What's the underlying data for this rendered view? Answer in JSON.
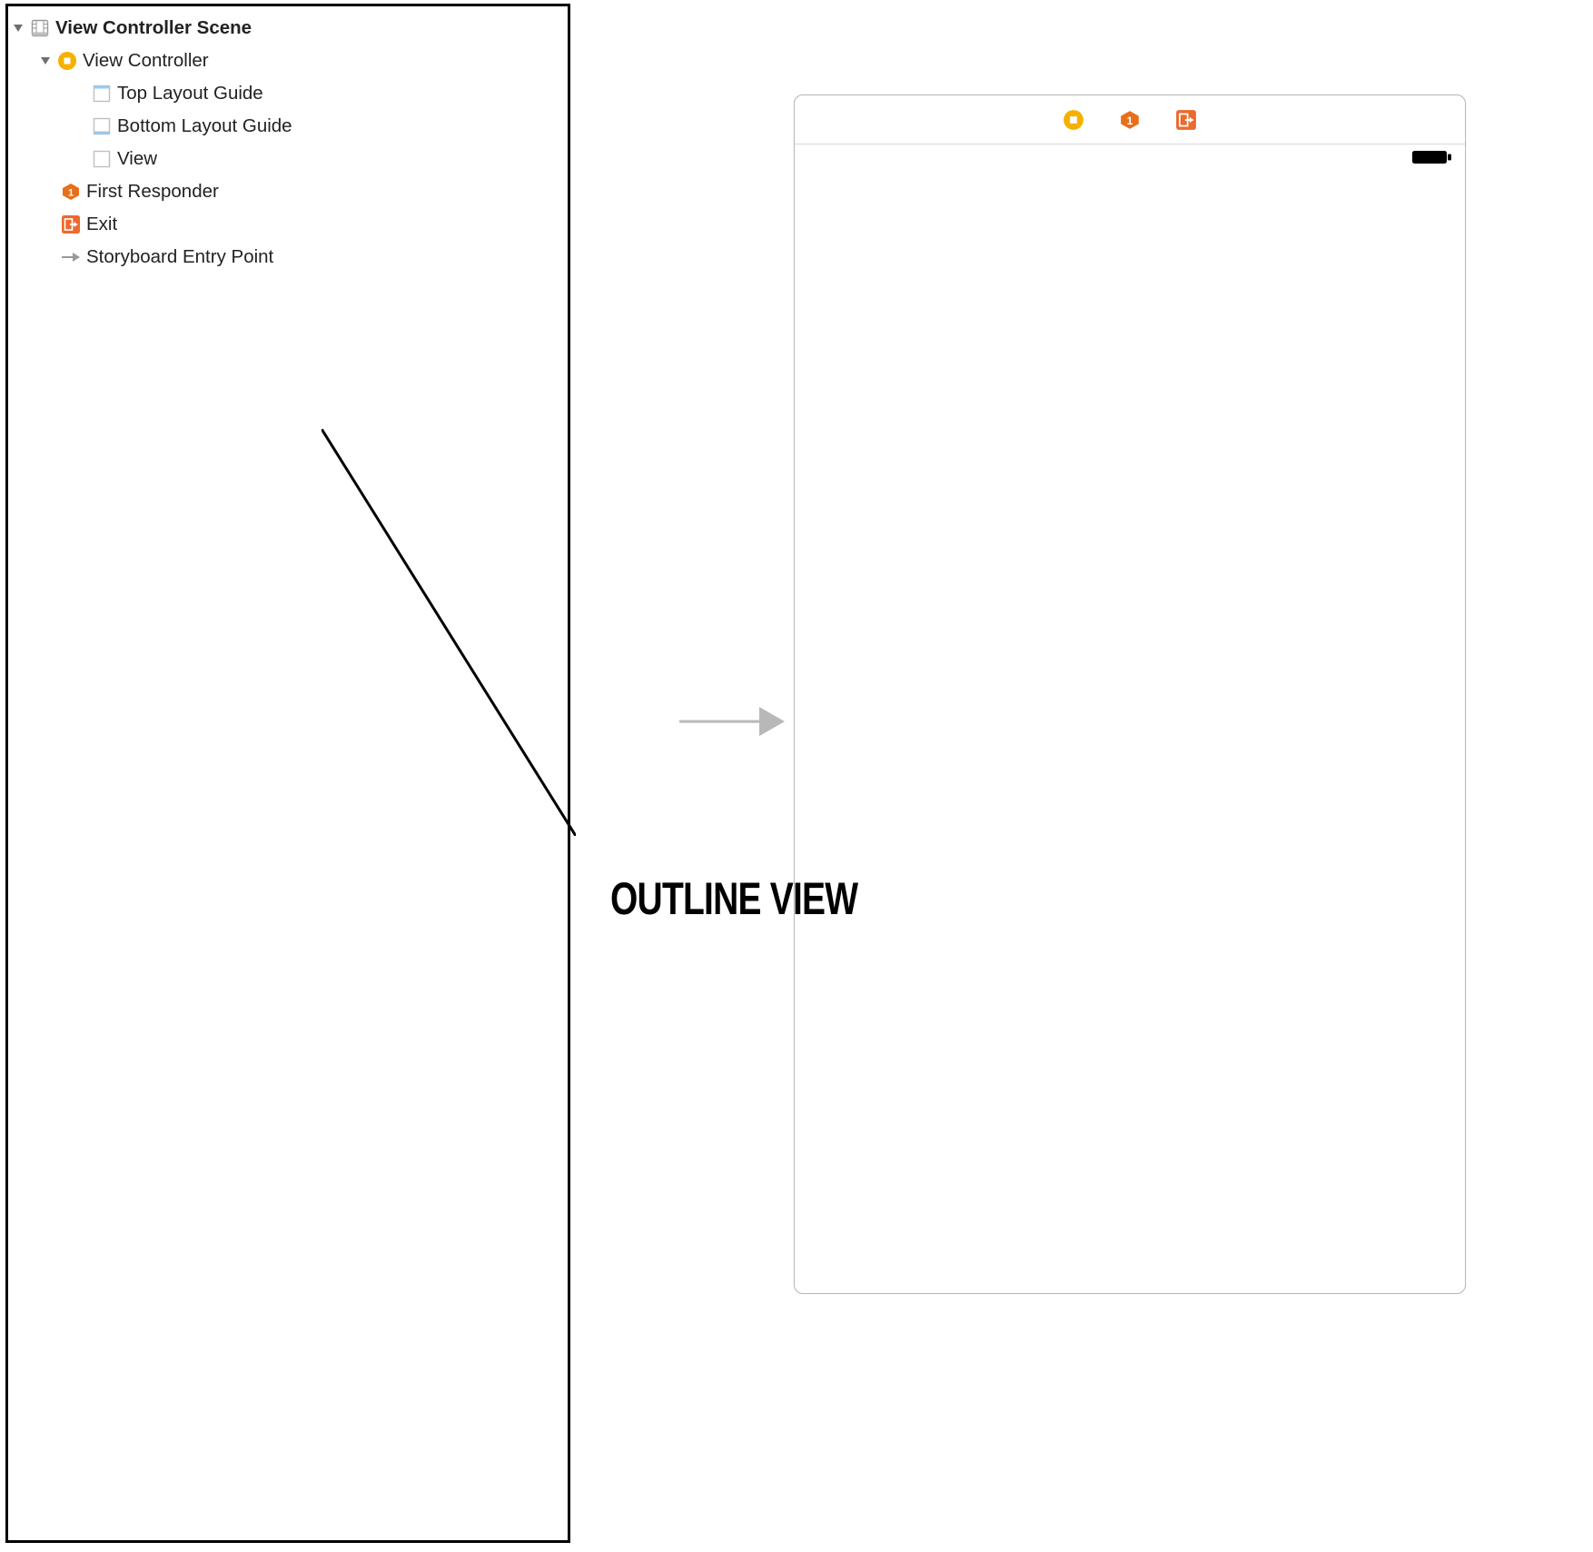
{
  "outline": {
    "scene_title": "View Controller Scene",
    "items": [
      {
        "label": "View Controller"
      },
      {
        "label": "Top Layout Guide"
      },
      {
        "label": "Bottom Layout Guide"
      },
      {
        "label": "View"
      },
      {
        "label": "First Responder"
      },
      {
        "label": "Exit"
      },
      {
        "label": "Storyboard Entry Point"
      }
    ]
  },
  "annotation": {
    "label": "OUTLINE VIEW"
  },
  "canvas": {
    "header_icons": [
      "view-controller-icon",
      "first-responder-icon",
      "exit-icon"
    ]
  }
}
